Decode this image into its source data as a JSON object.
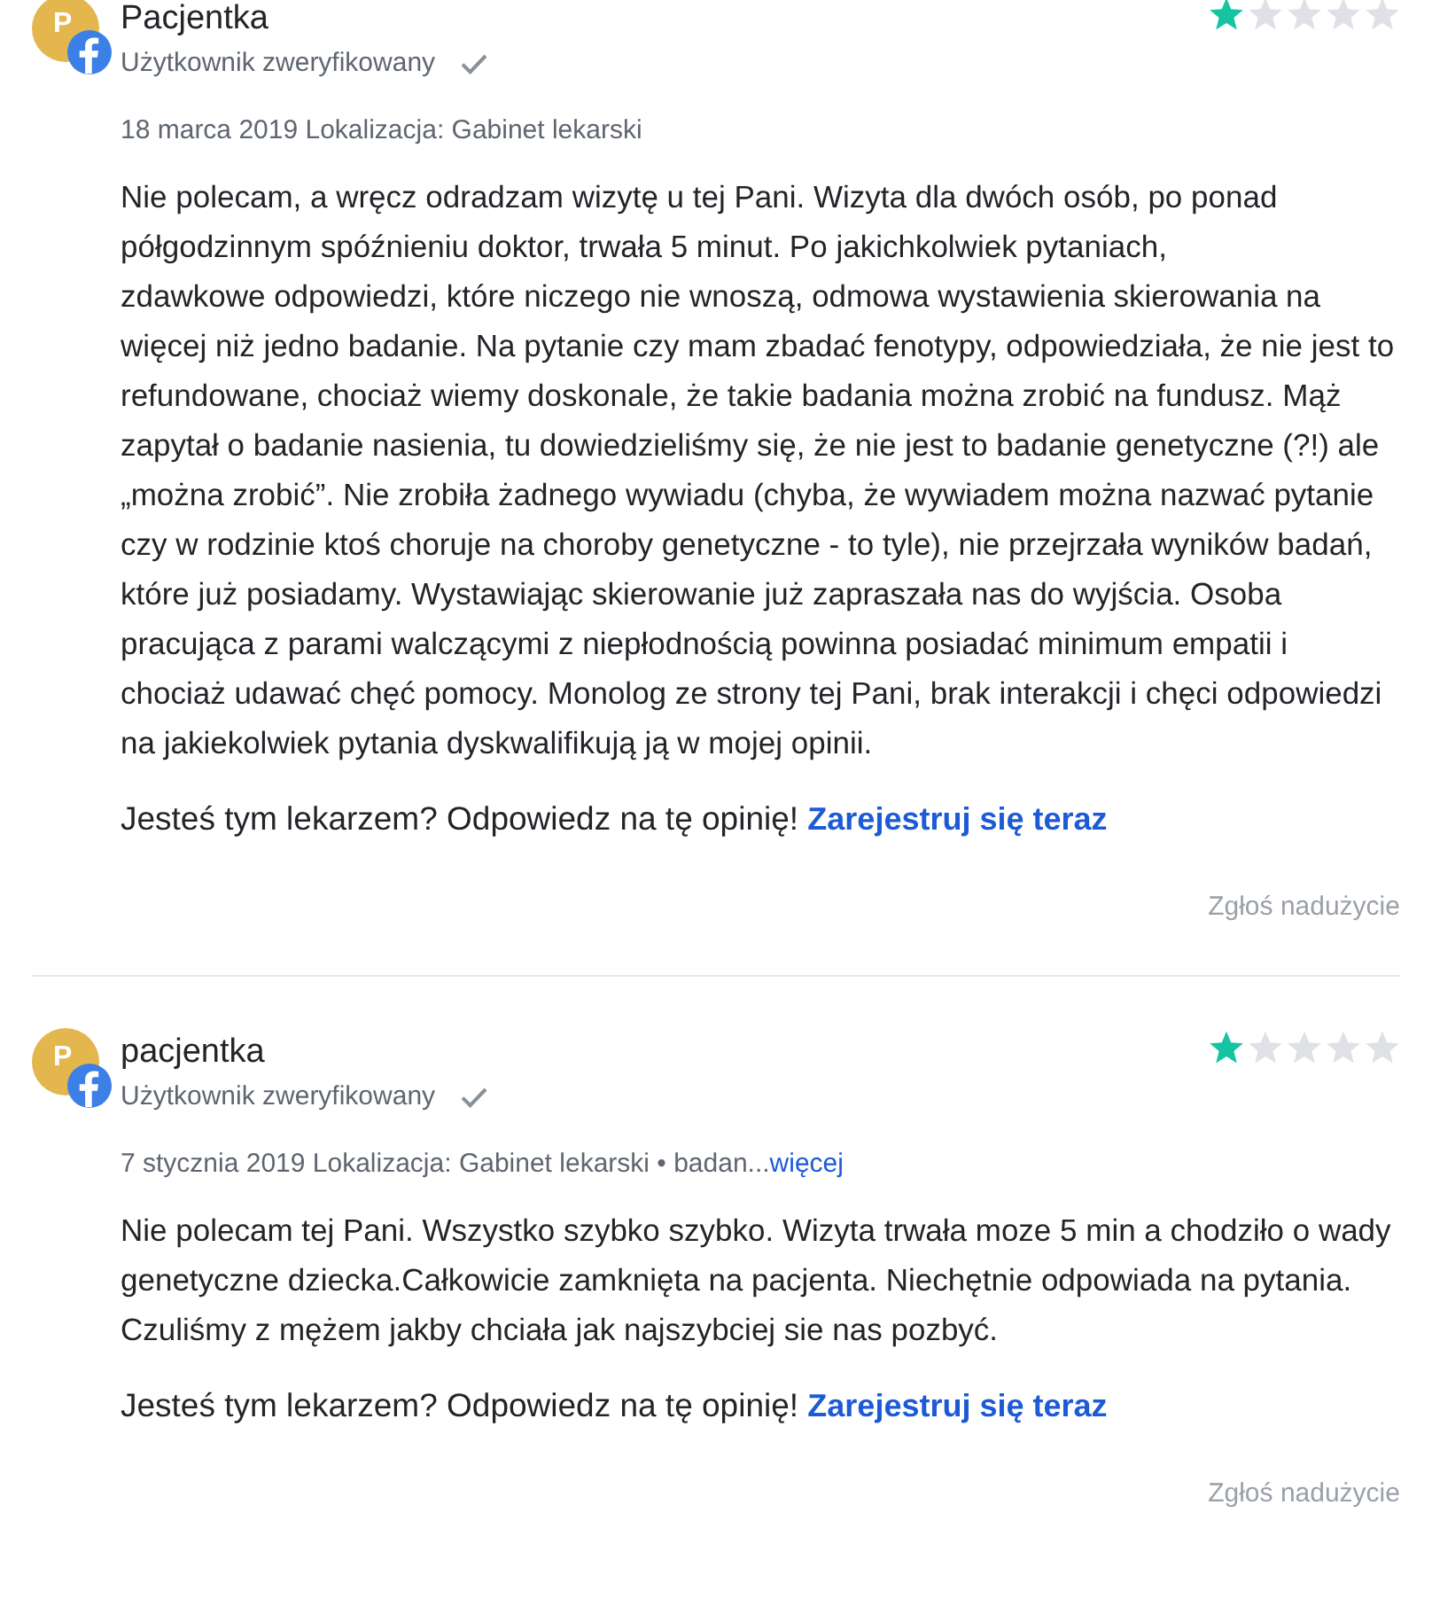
{
  "reviews": [
    {
      "author": "Pacjentka",
      "avatar_initial": "P",
      "badge": {
        "kind": "facebook"
      },
      "verified_label": "Użytkownik zweryfikowany",
      "verified": true,
      "stars": 1,
      "details": "18 marca 2019 Lokalizacja: Gabinet lekarski",
      "text": "Nie polecam, a wręcz odradzam wizytę u tej Pani. Wizyta dla dwóch osób, po ponad półgodzinnym spóźnieniu doktor, trwała 5 minut. Po jakichkolwiek pytaniach,\nzdawkowe odpowiedzi, które niczego nie wnoszą, odmowa wystawienia skierowania na więcej niż jedno badanie. Na pytanie czy mam zbadać fenotypy, odpowiedziała, że nie jest to refundowane, chociaż wiemy doskonale, że takie badania można zrobić na fundusz. Mąż zapytał o badanie nasienia, tu dowiedzieliśmy się, że nie jest to badanie genetyczne (?!) ale „można zrobić”. Nie zrobiła żadnego wywiadu (chyba, że wywiadem można nazwać pytanie czy w rodzinie ktoś choruje na choroby genetyczne - to tyle), nie przejrzała wyników badań, które już posiadamy. Wystawiając skierowanie już zapraszała nas do wyjścia. Osoba pracująca z parami walczącymi z niepłodnością powinna posiadać minimum empatii i chociaż udawać chęć pomocy. Monolog ze strony tej Pani, brak interakcji i chęci odpowiedzi na jakiekolwiek pytania dyskwalifikują ją w mojej opinii.",
      "reply_prompt": "Jesteś tym lekarzem? Odpowiedz na tę opinię!",
      "reply_link": "Zarejestruj się teraz",
      "report_link": "Zgłoś nadużycie"
    },
    {
      "author": "pacjentka",
      "avatar_initial": "P",
      "badge": {
        "kind": "facebook"
      },
      "verified_label": "Użytkownik zweryfikowany",
      "verified": true,
      "stars": 1,
      "details": "7 stycznia 2019 Lokalizacja: Gabinet lekarski • badan...",
      "more_link": "więcej",
      "text": "Nie polecam tej Pani. Wszystko szybko szybko. Wizyta trwała moze 5 min a chodziło o wady genetyczne dziecka.Całkowicie zamknięta na pacjenta. Niechętnie odpowiada na pytania. Czuliśmy z mężem jakby chciała jak najszybciej sie nas pozbyć.",
      "reply_prompt": "Jesteś tym lekarzem? Odpowiedz na tę opinię!",
      "reply_link": "Zarejestruj się teraz",
      "report_link": "Zgłoś nadużycie"
    }
  ]
}
